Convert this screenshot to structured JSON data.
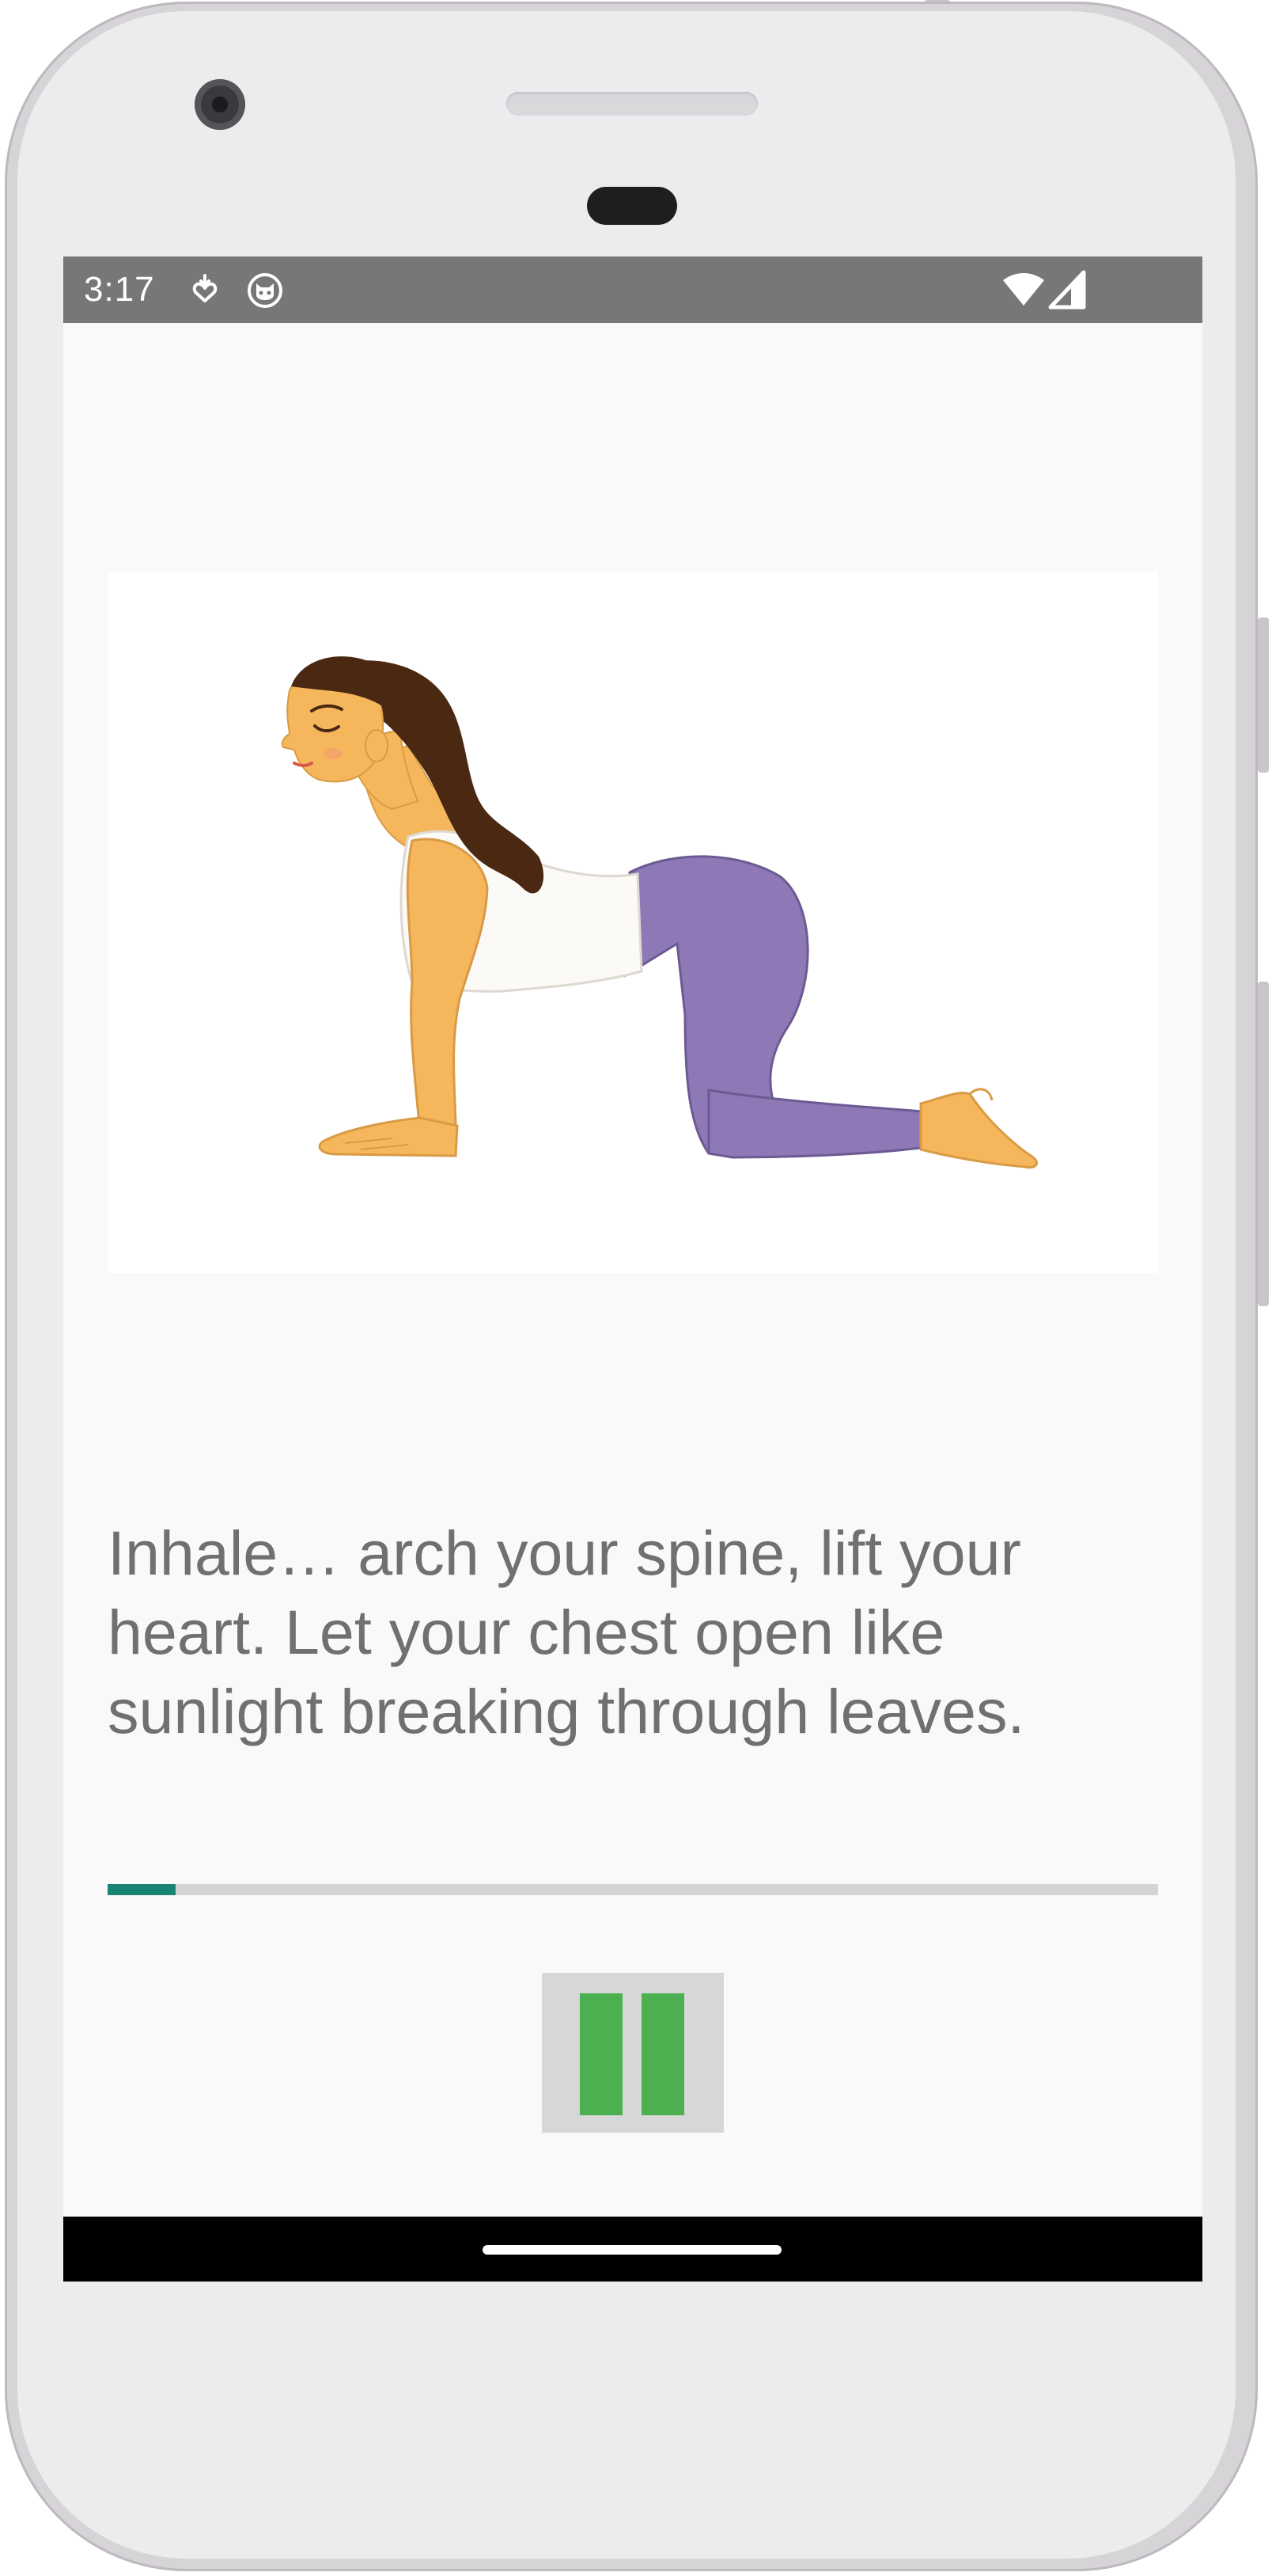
{
  "status_bar": {
    "time": "3:17",
    "left_icons": [
      "download-heart-icon",
      "cat-face-icon"
    ],
    "right_icons": [
      "wifi-icon",
      "cellular-signal-icon"
    ],
    "background_color": "#777777"
  },
  "exercise": {
    "illustration": "cat-cow-yoga-pose-illustration",
    "instruction": "Inhale… arch your spine, lift your heart. Let your chest open like sunlight breaking through leaves.",
    "progress": 0.065,
    "progress_color": "#1a8474"
  },
  "controls": {
    "pause_icon": "pause-icon",
    "pause_color": "#4cb050"
  },
  "navigation": {
    "home_indicator": "home-pill"
  }
}
